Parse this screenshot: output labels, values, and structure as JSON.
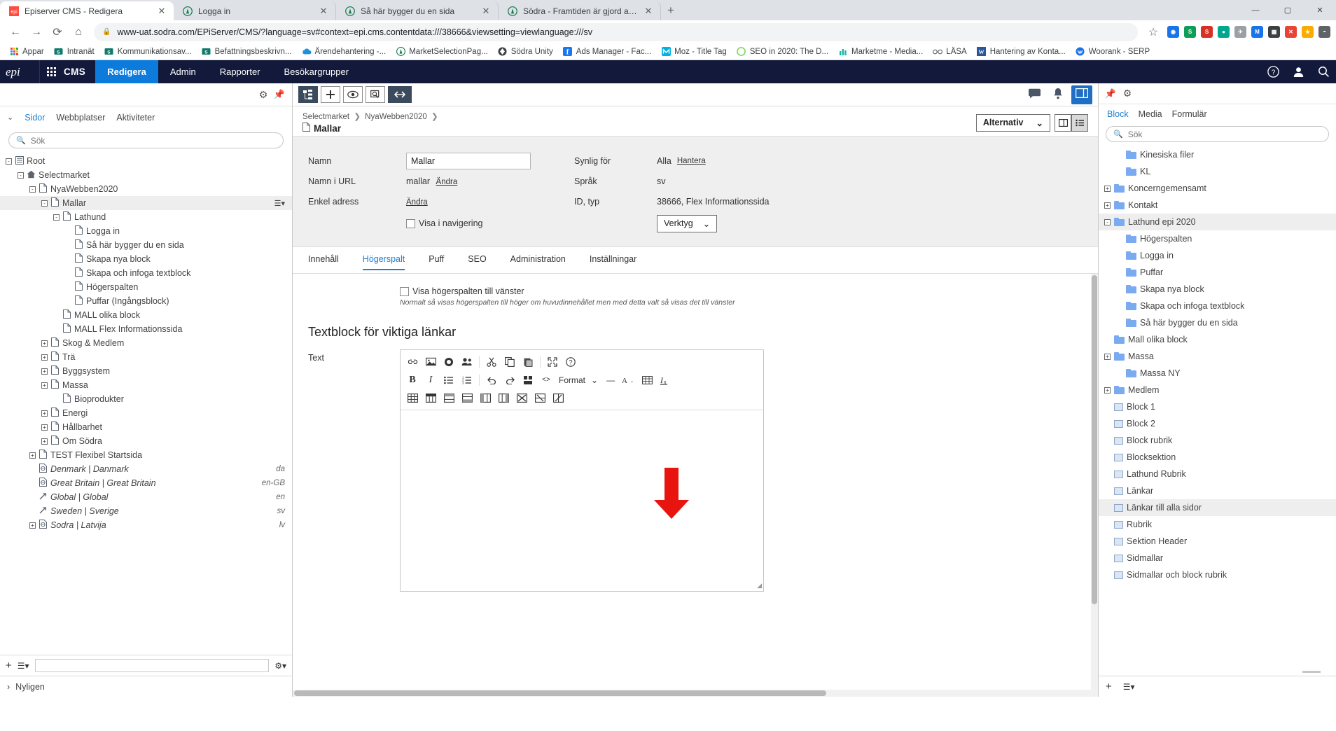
{
  "browser": {
    "tabs": [
      {
        "title": "Episerver CMS - Redigera",
        "favicon": "epi-logo-icon",
        "active": true
      },
      {
        "title": "Logga in",
        "favicon": "sodra-icon",
        "active": false
      },
      {
        "title": "Så här bygger du en sida",
        "favicon": "sodra-icon",
        "active": false
      },
      {
        "title": "Södra - Framtiden är gjord av tra",
        "favicon": "sodra-icon",
        "active": false
      }
    ],
    "new_tab_label": "+",
    "window_controls": [
      "—",
      "▢",
      "✕"
    ],
    "nav": {
      "back": "←",
      "forward": "→",
      "reload": "⟳",
      "home": "⌂"
    },
    "url": "www-uat.sodra.com/EPiServer/CMS/?language=sv#context=epi.cms.contentdata:///38666&viewsetting=viewlanguage:///sv",
    "lock_icon": "lock-icon",
    "star_icon": "star-icon",
    "extensions": [
      {
        "name": "ext-blue",
        "color": "#1a73e8",
        "glyph": "◉"
      },
      {
        "name": "ext-green",
        "color": "#0f9d58",
        "glyph": "S"
      },
      {
        "name": "ext-red",
        "color": "#d93025",
        "glyph": "S"
      },
      {
        "name": "ext-teal",
        "color": "#00a78e",
        "glyph": "●"
      },
      {
        "name": "ext-grey",
        "color": "#9aa0a6",
        "glyph": "✈"
      },
      {
        "name": "ext-blue2",
        "color": "#1a73e8",
        "glyph": "M"
      },
      {
        "name": "ext-dark",
        "color": "#3c4043",
        "glyph": "▦"
      },
      {
        "name": "ext-red2",
        "color": "#ea4335",
        "glyph": "✕"
      },
      {
        "name": "ext-yellow",
        "color": "#f9ab00",
        "glyph": "★"
      },
      {
        "name": "ext-avatar",
        "color": "#5f6368",
        "glyph": "◓"
      }
    ],
    "bookmarks": [
      {
        "label": "Appar",
        "icon": "apps-grid-icon",
        "color": "#4285f4"
      },
      {
        "label": "Intranät",
        "icon": "sharepoint-icon",
        "color": "#0f7a6c"
      },
      {
        "label": "Kommunikationsav...",
        "icon": "sharepoint-icon",
        "color": "#0f7a6c"
      },
      {
        "label": "Befattningsbeskrivn...",
        "icon": "sharepoint-icon",
        "color": "#0f7a6c"
      },
      {
        "label": "Ärendehantering -...",
        "icon": "cloud-icon",
        "color": "#1a8fe3"
      },
      {
        "label": "MarketSelectionPag...",
        "icon": "sodra-icon",
        "color": "#0f7a4c"
      },
      {
        "label": "Södra Unity",
        "icon": "unity-icon",
        "color": "#3c4043"
      },
      {
        "label": "Ads Manager - Fac...",
        "icon": "facebook-icon",
        "color": "#1877f2"
      },
      {
        "label": "Moz - Title Tag",
        "icon": "moz-icon",
        "color": "#00b2e3"
      },
      {
        "label": "SEO in 2020: The D...",
        "icon": "circle-icon",
        "color": "#7ed957"
      },
      {
        "label": "Marketme - Media...",
        "icon": "bars-icon",
        "color": "#14b8a6"
      },
      {
        "label": "LÄSA",
        "icon": "glasses-icon",
        "color": "#5f6368"
      },
      {
        "label": "Hantering av Konta...",
        "icon": "word-icon",
        "color": "#2b579a"
      },
      {
        "label": "Woorank - SERP",
        "icon": "woorank-icon",
        "color": "#1a73e8"
      }
    ]
  },
  "epi_header": {
    "logo": "episerver-logo",
    "waffle": "apps-waffle-icon",
    "product": "CMS",
    "nav": [
      {
        "label": "Redigera",
        "selected": true
      },
      {
        "label": "Admin",
        "selected": false
      },
      {
        "label": "Rapporter",
        "selected": false
      },
      {
        "label": "Besökargrupper",
        "selected": false
      }
    ],
    "right_icons": [
      {
        "name": "help-icon",
        "glyph": "?"
      },
      {
        "name": "user-icon",
        "glyph": "👤"
      },
      {
        "name": "search-icon",
        "glyph": "🔍"
      }
    ]
  },
  "left_panel": {
    "gear_icon": "gear-icon",
    "pin_icon": "pin-icon",
    "chevron_icon": "chevron-down-icon",
    "tabs": [
      {
        "label": "Sidor",
        "selected": true
      },
      {
        "label": "Webbplatser",
        "selected": false
      },
      {
        "label": "Aktiviteter",
        "selected": false
      }
    ],
    "search_placeholder": "Sök",
    "search_value": "",
    "tree": [
      {
        "label": "Root",
        "indent": 0,
        "exp": "-",
        "icon": "root-icon",
        "sel": false,
        "lang": "",
        "italic": false
      },
      {
        "label": "Selectmarket",
        "indent": 1,
        "exp": "-",
        "icon": "home-icon",
        "sel": false,
        "lang": "",
        "italic": false
      },
      {
        "label": "NyaWebben2020",
        "indent": 2,
        "exp": "-",
        "icon": "page-icon",
        "sel": false,
        "lang": "",
        "italic": false
      },
      {
        "label": "Mallar",
        "indent": 3,
        "exp": "-",
        "icon": "page-icon",
        "sel": true,
        "lang": "",
        "italic": false,
        "menu": true
      },
      {
        "label": "Lathund",
        "indent": 4,
        "exp": "-",
        "icon": "page-icon",
        "sel": false,
        "lang": "",
        "italic": false
      },
      {
        "label": "Logga in",
        "indent": 5,
        "exp": "",
        "icon": "page-icon",
        "sel": false,
        "lang": "",
        "italic": false
      },
      {
        "label": "Så här bygger du en sida",
        "indent": 5,
        "exp": "",
        "icon": "page-icon",
        "sel": false,
        "lang": "",
        "italic": false
      },
      {
        "label": "Skapa nya block",
        "indent": 5,
        "exp": "",
        "icon": "page-icon",
        "sel": false,
        "lang": "",
        "italic": false
      },
      {
        "label": "Skapa och infoga textblock",
        "indent": 5,
        "exp": "",
        "icon": "page-icon",
        "sel": false,
        "lang": "",
        "italic": false
      },
      {
        "label": "Högerspalten",
        "indent": 5,
        "exp": "",
        "icon": "page-icon",
        "sel": false,
        "lang": "",
        "italic": false
      },
      {
        "label": "Puffar (Ingångsblock)",
        "indent": 5,
        "exp": "",
        "icon": "page-icon",
        "sel": false,
        "lang": "",
        "italic": false
      },
      {
        "label": "MALL olika block",
        "indent": 4,
        "exp": "",
        "icon": "page-icon",
        "sel": false,
        "lang": "",
        "italic": false
      },
      {
        "label": "MALL Flex Informationssida",
        "indent": 4,
        "exp": "",
        "icon": "page-icon",
        "sel": false,
        "lang": "",
        "italic": false
      },
      {
        "label": "Skog & Medlem",
        "indent": 3,
        "exp": "+",
        "icon": "page-icon",
        "sel": false,
        "lang": "",
        "italic": false
      },
      {
        "label": "Trä",
        "indent": 3,
        "exp": "+",
        "icon": "page-icon",
        "sel": false,
        "lang": "",
        "italic": false
      },
      {
        "label": "Byggsystem",
        "indent": 3,
        "exp": "+",
        "icon": "page-icon",
        "sel": false,
        "lang": "",
        "italic": false
      },
      {
        "label": "Massa",
        "indent": 3,
        "exp": "+",
        "icon": "page-icon",
        "sel": false,
        "lang": "",
        "italic": false
      },
      {
        "label": "Bioprodukter",
        "indent": 4,
        "exp": "",
        "icon": "page-icon",
        "sel": false,
        "lang": "",
        "italic": false
      },
      {
        "label": "Energi",
        "indent": 3,
        "exp": "+",
        "icon": "page-icon",
        "sel": false,
        "lang": "",
        "italic": false
      },
      {
        "label": "Hållbarhet",
        "indent": 3,
        "exp": "+",
        "icon": "page-icon",
        "sel": false,
        "lang": "",
        "italic": false
      },
      {
        "label": "Om Södra",
        "indent": 3,
        "exp": "+",
        "icon": "page-icon",
        "sel": false,
        "lang": "",
        "italic": false
      },
      {
        "label": "TEST Flexibel Startsida",
        "indent": 2,
        "exp": "+",
        "icon": "page-icon",
        "sel": false,
        "lang": "",
        "italic": false
      },
      {
        "label": "Denmark | Danmark",
        "indent": 2,
        "exp": "",
        "icon": "globe-page-icon",
        "sel": false,
        "lang": "da",
        "italic": true
      },
      {
        "label": "Great Britain | Great Britain",
        "indent": 2,
        "exp": "",
        "icon": "globe-page-icon",
        "sel": false,
        "lang": "en-GB",
        "italic": true
      },
      {
        "label": "Global | Global",
        "indent": 2,
        "exp": "",
        "icon": "shortcut-icon",
        "sel": false,
        "lang": "en",
        "italic": true
      },
      {
        "label": "Sweden | Sverige",
        "indent": 2,
        "exp": "",
        "icon": "shortcut-icon",
        "sel": false,
        "lang": "sv",
        "italic": true
      },
      {
        "label": "Sodra | Latvija",
        "indent": 2,
        "exp": "+",
        "icon": "globe-page-icon",
        "sel": false,
        "lang": "lv",
        "italic": true
      }
    ],
    "footer": {
      "add_icon": "plus-icon",
      "list_icon": "list-menu-icon",
      "settings_icon": "gear-icon",
      "input_value": ""
    },
    "recent": {
      "label": "Nyligen",
      "chevron": "chevron-right-icon"
    }
  },
  "center_panel": {
    "toolbar_buttons": [
      {
        "name": "toggle-structure-button",
        "glyph": "▤",
        "dark": true
      },
      {
        "name": "add-content-button",
        "glyph": "+",
        "dark": false
      },
      {
        "name": "preview-button",
        "glyph": "👁",
        "dark": false
      },
      {
        "name": "compare-button",
        "glyph": "🔍",
        "dark": false
      },
      {
        "name": "expand-button",
        "glyph": "↔",
        "dark": false,
        "wide": true
      }
    ],
    "right_icons": [
      {
        "name": "comments-icon",
        "glyph": "💬"
      },
      {
        "name": "notifications-bell-icon",
        "glyph": "🔔"
      },
      {
        "name": "assets-panel-icon",
        "glyph": "▣"
      }
    ],
    "breadcrumb": [
      "Selectmarket",
      "NyaWebben2020"
    ],
    "page_title": "Mallar",
    "page_icon": "page-icon",
    "options_button": "Alternativ",
    "options_chevron": "chevron-down-icon",
    "view_toggles": [
      {
        "name": "split-view-button",
        "glyph": "▯",
        "on": false
      },
      {
        "name": "list-view-button",
        "glyph": "☰",
        "on": true
      }
    ],
    "form": {
      "namn_label": "Namn",
      "namn_value": "Mallar",
      "namn_url_label": "Namn i URL",
      "namn_url_value": "mallar",
      "namn_url_link": "Ändra",
      "enkel_adress_label": "Enkel adress",
      "enkel_adress_link": "Ändra",
      "visa_i_nav_label": "Visa i navigering",
      "visa_i_nav_checked": false,
      "synlig_label": "Synlig för",
      "synlig_value": "Alla",
      "synlig_link": "Hantera",
      "sprak_label": "Språk",
      "sprak_value": "sv",
      "id_label": "ID, typ",
      "id_value": "38666, Flex Informationssida",
      "verktyg_label": "Verktyg",
      "verktyg_chevron": "chevron-down-icon"
    },
    "tabs": [
      {
        "label": "Innehåll",
        "selected": false
      },
      {
        "label": "Högerspalt",
        "selected": true
      },
      {
        "label": "Puff",
        "selected": false
      },
      {
        "label": "SEO",
        "selected": false
      },
      {
        "label": "Administration",
        "selected": false
      },
      {
        "label": "Inställningar",
        "selected": false
      }
    ],
    "content": {
      "checkbox_label": "Visa högerspalten till vänster",
      "checkbox_checked": false,
      "hint": "Normalt så visas högerspalten till höger om huvudinnehållet men med detta valt så visas det till vänster",
      "heading": "Textblock för viktiga länkar",
      "text_label": "Text",
      "resize_icon": "resize-handle-icon"
    },
    "editor_toolbar": {
      "row1": [
        {
          "name": "link-icon",
          "glyph": "🔗"
        },
        {
          "name": "image-icon",
          "glyph": "▣"
        },
        {
          "name": "block-icon",
          "glyph": "⬤"
        },
        {
          "name": "personalize-icon",
          "glyph": "👥"
        },
        {
          "name": "cut-icon",
          "glyph": "✂"
        },
        {
          "name": "copy-icon",
          "glyph": "⧉"
        },
        {
          "name": "paste-icon",
          "glyph": "📋"
        },
        {
          "name": "fullscreen-icon",
          "glyph": "⛶"
        },
        {
          "name": "help-icon",
          "glyph": "?"
        }
      ],
      "row2": [
        {
          "name": "bold-icon",
          "glyph": "B"
        },
        {
          "name": "italic-icon",
          "glyph": "I"
        },
        {
          "name": "bullet-list-icon",
          "glyph": "☰"
        },
        {
          "name": "numbered-list-icon",
          "glyph": "⒈"
        },
        {
          "name": "undo-icon",
          "glyph": "↶"
        },
        {
          "name": "redo-icon",
          "glyph": "↷"
        },
        {
          "name": "anchor-icon",
          "glyph": "⚓"
        },
        {
          "name": "source-code-icon",
          "glyph": "<>"
        }
      ],
      "format_label": "Format",
      "format_chevron": "chevron-down-icon",
      "row2b": [
        {
          "name": "horizontal-rule-icon",
          "glyph": "—"
        },
        {
          "name": "text-color-icon",
          "glyph": "A"
        },
        {
          "name": "special-char-icon",
          "glyph": "▦"
        },
        {
          "name": "clear-format-icon",
          "glyph": "Ix"
        }
      ],
      "row3": [
        {
          "name": "insert-table-icon",
          "glyph": "▦"
        },
        {
          "name": "table-props-icon",
          "glyph": "▥"
        },
        {
          "name": "insert-row-before-icon",
          "glyph": "▤"
        },
        {
          "name": "insert-row-after-icon",
          "glyph": "▤"
        },
        {
          "name": "insert-col-before-icon",
          "glyph": "▥"
        },
        {
          "name": "insert-col-after-icon",
          "glyph": "▦"
        },
        {
          "name": "delete-table-icon",
          "glyph": "⊠"
        },
        {
          "name": "delete-row-icon",
          "glyph": "⊟"
        },
        {
          "name": "delete-col-icon",
          "glyph": "⊟"
        }
      ]
    },
    "annotation": {
      "type": "red-arrow",
      "points_to": "Högerspalt tab"
    }
  },
  "right_panel": {
    "pin_icon": "pin-icon",
    "gear_icon": "gear-icon",
    "tabs": [
      {
        "label": "Block",
        "selected": true
      },
      {
        "label": "Media",
        "selected": false
      },
      {
        "label": "Formulär",
        "selected": false
      }
    ],
    "search_placeholder": "Sök",
    "search_value": "",
    "items": [
      {
        "label": "Kinesiska filer",
        "indent": 1,
        "exp": "",
        "type": "folder",
        "sel": false
      },
      {
        "label": "KL",
        "indent": 1,
        "exp": "",
        "type": "folder",
        "sel": false
      },
      {
        "label": "Koncerngemensamt",
        "indent": 0,
        "exp": "+",
        "type": "folder",
        "sel": false
      },
      {
        "label": "Kontakt",
        "indent": 0,
        "exp": "+",
        "type": "folder",
        "sel": false
      },
      {
        "label": "Lathund epi 2020",
        "indent": 0,
        "exp": "-",
        "type": "folder",
        "sel": true
      },
      {
        "label": "Högerspalten",
        "indent": 1,
        "exp": "",
        "type": "folder",
        "sel": false
      },
      {
        "label": "Logga in",
        "indent": 1,
        "exp": "",
        "type": "folder",
        "sel": false
      },
      {
        "label": "Puffar",
        "indent": 1,
        "exp": "",
        "type": "folder",
        "sel": false
      },
      {
        "label": "Skapa nya block",
        "indent": 1,
        "exp": "",
        "type": "folder",
        "sel": false
      },
      {
        "label": "Skapa och infoga textblock",
        "indent": 1,
        "exp": "",
        "type": "folder",
        "sel": false
      },
      {
        "label": "Så här bygger du en sida",
        "indent": 1,
        "exp": "",
        "type": "folder",
        "sel": false
      },
      {
        "label": "Mall olika block",
        "indent": 0,
        "exp": "",
        "type": "folder",
        "sel": false
      },
      {
        "label": "Massa",
        "indent": 0,
        "exp": "+",
        "type": "folder",
        "sel": false
      },
      {
        "label": "Massa NY",
        "indent": 1,
        "exp": "",
        "type": "folder",
        "sel": false
      },
      {
        "label": "Medlem",
        "indent": 0,
        "exp": "+",
        "type": "folder",
        "sel": false
      },
      {
        "label": "Block 1",
        "indent": 0,
        "exp": "",
        "type": "block",
        "sel": false
      },
      {
        "label": "Block 2",
        "indent": 0,
        "exp": "",
        "type": "block",
        "sel": false
      },
      {
        "label": "Block rubrik",
        "indent": 0,
        "exp": "",
        "type": "block",
        "sel": false
      },
      {
        "label": "Blocksektion",
        "indent": 0,
        "exp": "",
        "type": "block",
        "sel": false
      },
      {
        "label": "Lathund Rubrik",
        "indent": 0,
        "exp": "",
        "type": "block",
        "sel": false
      },
      {
        "label": "Länkar",
        "indent": 0,
        "exp": "",
        "type": "block",
        "sel": false
      },
      {
        "label": "Länkar till alla sidor",
        "indent": 0,
        "exp": "",
        "type": "block",
        "sel": true
      },
      {
        "label": "Rubrik",
        "indent": 0,
        "exp": "",
        "type": "block",
        "sel": false
      },
      {
        "label": "Sektion Header",
        "indent": 0,
        "exp": "",
        "type": "block",
        "sel": false
      },
      {
        "label": "Sidmallar",
        "indent": 0,
        "exp": "",
        "type": "block",
        "sel": false
      },
      {
        "label": "Sidmallar och block rubrik",
        "indent": 0,
        "exp": "",
        "type": "block",
        "sel": false
      }
    ],
    "footer": {
      "add_icon": "plus-icon",
      "list_icon": "list-menu-icon"
    }
  },
  "colors": {
    "epi_navy": "#12193b",
    "epi_blue": "#0c7bdc",
    "link_blue": "#1f7fd0",
    "annotation_red": "#e8140f",
    "folder_blue": "#7aaaf0",
    "form_grey": "#efefef"
  }
}
